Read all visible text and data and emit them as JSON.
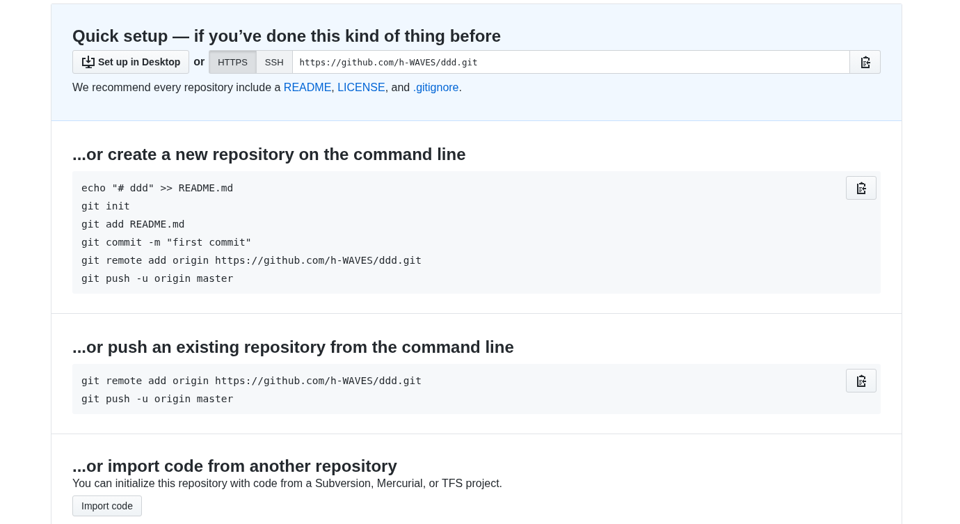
{
  "quick_setup": {
    "title": "Quick setup — if you’ve done this kind of thing before",
    "desktop_button": "Set up in Desktop",
    "or": "or",
    "protocols": [
      {
        "label": "HTTPS",
        "selected": true
      },
      {
        "label": "SSH",
        "selected": false
      }
    ],
    "url": "https://github.com/h-WAVES/ddd.git",
    "recommend": [
      {
        "kind": "text",
        "text": "We recommend every repository include a "
      },
      {
        "kind": "link",
        "text": "README"
      },
      {
        "kind": "text",
        "text": ", "
      },
      {
        "kind": "link",
        "text": "LICENSE"
      },
      {
        "kind": "text",
        "text": ", and "
      },
      {
        "kind": "link",
        "text": ".gitignore"
      },
      {
        "kind": "text",
        "text": "."
      }
    ]
  },
  "sections": [
    {
      "title": "...or create a new repository on the command line",
      "code": [
        "echo \"# ddd\" >> README.md",
        "git init",
        "git add README.md",
        "git commit -m \"first commit\"",
        "git remote add origin https://github.com/h-WAVES/ddd.git",
        "git push -u origin master"
      ]
    },
    {
      "title": "...or push an existing repository from the command line",
      "code": [
        "git remote add origin https://github.com/h-WAVES/ddd.git",
        "git push -u origin master"
      ]
    }
  ],
  "import": {
    "title": "...or import code from another repository",
    "description": "You can initialize this repository with code from a Subversion, Mercurial, or TFS project.",
    "button": "Import code"
  }
}
